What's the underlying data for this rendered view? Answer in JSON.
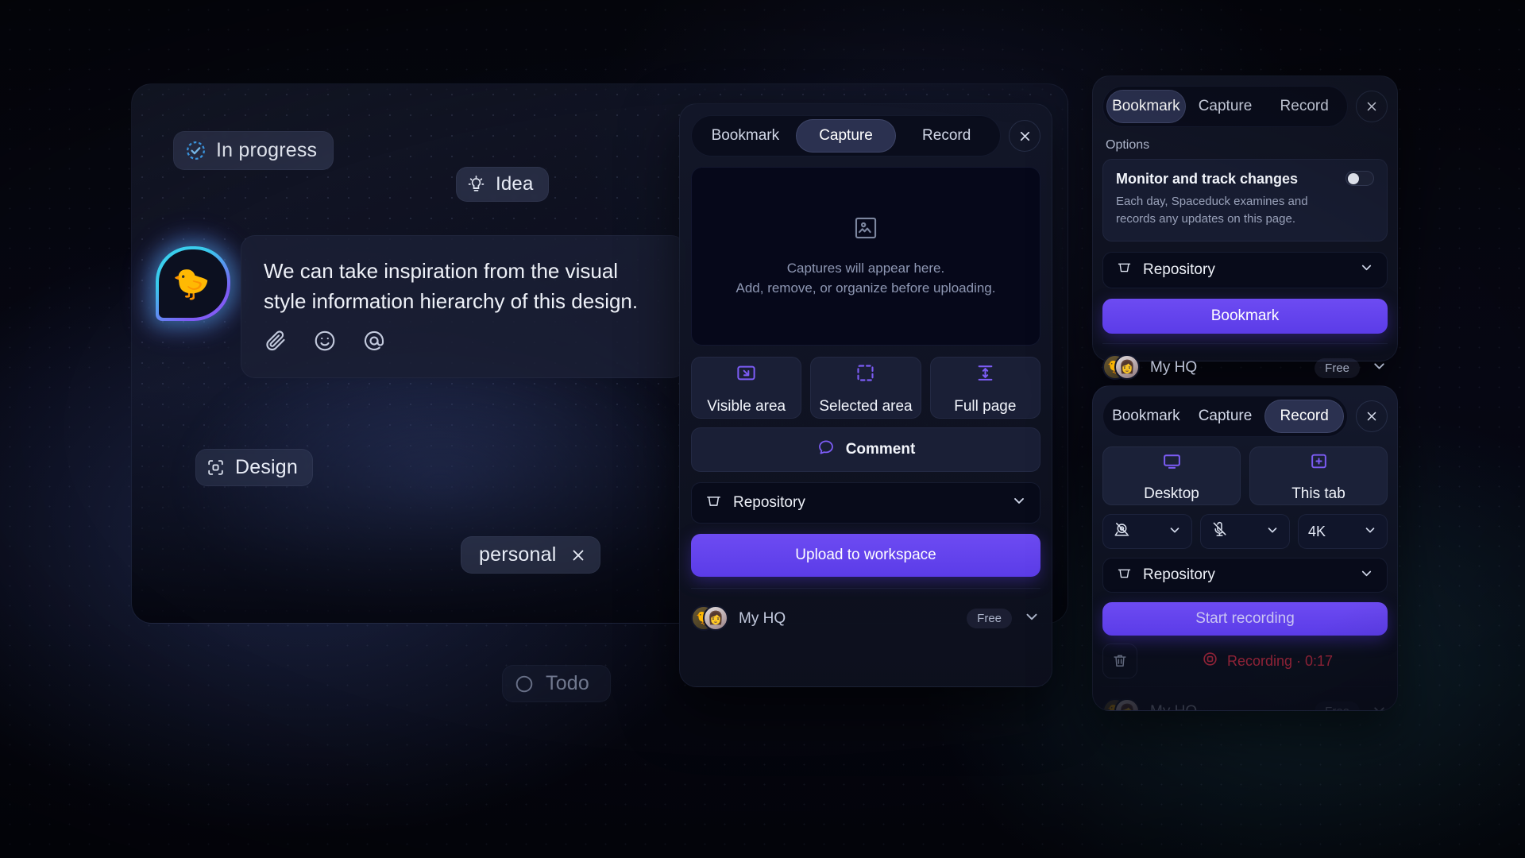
{
  "board": {
    "pills": [
      {
        "id": "in-progress",
        "label": "In progress",
        "icon": "check-circle-icon"
      },
      {
        "id": "idea",
        "label": "Idea",
        "icon": "lightbulb-icon"
      },
      {
        "id": "design",
        "label": "Design",
        "icon": "component-icon"
      },
      {
        "id": "personal",
        "label": "personal",
        "icon": "close-icon"
      },
      {
        "id": "todo",
        "label": "Todo",
        "icon": "circle-icon"
      }
    ],
    "message": {
      "text": "We can take inspiration from the visual style information hierarchy of this design.",
      "avatar_icon": "duck-avatar",
      "actions": [
        {
          "name": "attach-icon",
          "label": "Attach"
        },
        {
          "name": "emoji-icon",
          "label": "Emoji"
        },
        {
          "name": "mention-icon",
          "label": "Mention"
        }
      ]
    }
  },
  "capture_panel": {
    "tabs": [
      {
        "label": "Bookmark",
        "active": false
      },
      {
        "label": "Capture",
        "active": true
      },
      {
        "label": "Record",
        "active": false
      }
    ],
    "close_label": "×",
    "preview": {
      "icon": "image-placeholder-icon",
      "line1": "Captures will appear here.",
      "line2": "Add, remove, or organize before uploading."
    },
    "modes": [
      {
        "label": "Visible area",
        "icon": "expand-frame-icon"
      },
      {
        "label": "Selected area",
        "icon": "dashed-square-icon"
      },
      {
        "label": "Full page",
        "icon": "full-page-icon"
      }
    ],
    "comment_button": {
      "label": "Comment",
      "icon": "comment-bubble-icon"
    },
    "repository_select": {
      "label": "Repository",
      "icon": "bucket-icon",
      "chevron": "chevron-down-icon"
    },
    "primary_button": "Upload to workspace",
    "workspace": {
      "name": "My HQ",
      "plan": "Free",
      "chevron": "chevron-down-icon"
    }
  },
  "bookmark_panel": {
    "tabs": [
      {
        "label": "Bookmark",
        "active": true
      },
      {
        "label": "Capture",
        "active": false
      },
      {
        "label": "Record",
        "active": false
      }
    ],
    "close_label": "×",
    "options_label": "Options",
    "option": {
      "title": "Monitor and track changes",
      "description": "Each day, Spaceduck examines and records any updates on this page.",
      "toggle_on": false
    },
    "repository_select": {
      "label": "Repository",
      "icon": "bucket-icon",
      "chevron": "chevron-down-icon"
    },
    "primary_button": "Bookmark",
    "workspace": {
      "name": "My HQ",
      "plan": "Free",
      "chevron": "chevron-down-icon"
    }
  },
  "record_panel": {
    "tabs": [
      {
        "label": "Bookmark",
        "active": false
      },
      {
        "label": "Capture",
        "active": false
      },
      {
        "label": "Record",
        "active": true
      }
    ],
    "close_label": "×",
    "sources": [
      {
        "label": "Desktop",
        "icon": "monitor-icon"
      },
      {
        "label": "This tab",
        "icon": "tab-plus-icon"
      }
    ],
    "controls": [
      {
        "name": "camera-off-select",
        "icon": "camera-off-icon",
        "value": ""
      },
      {
        "name": "microphone-off-select",
        "icon": "microphone-off-icon",
        "value": ""
      },
      {
        "name": "resolution-select",
        "icon": "",
        "value": "4K"
      }
    ],
    "repository_select": {
      "label": "Repository",
      "icon": "bucket-icon",
      "chevron": "chevron-down-icon"
    },
    "primary_button": "Start recording",
    "recording_status": {
      "label": "Recording · 0:17",
      "icon": "record-stop-icon",
      "color": "#b3283f"
    },
    "delete_icon": "trash-icon",
    "workspace": {
      "name": "My HQ",
      "plan": "Free",
      "chevron": "chevron-down-icon"
    }
  },
  "theme": {
    "accent": "#6d4bf2",
    "panel_bg": "#131728",
    "preview_bg": "#06081a",
    "record_red": "#b3283f"
  }
}
